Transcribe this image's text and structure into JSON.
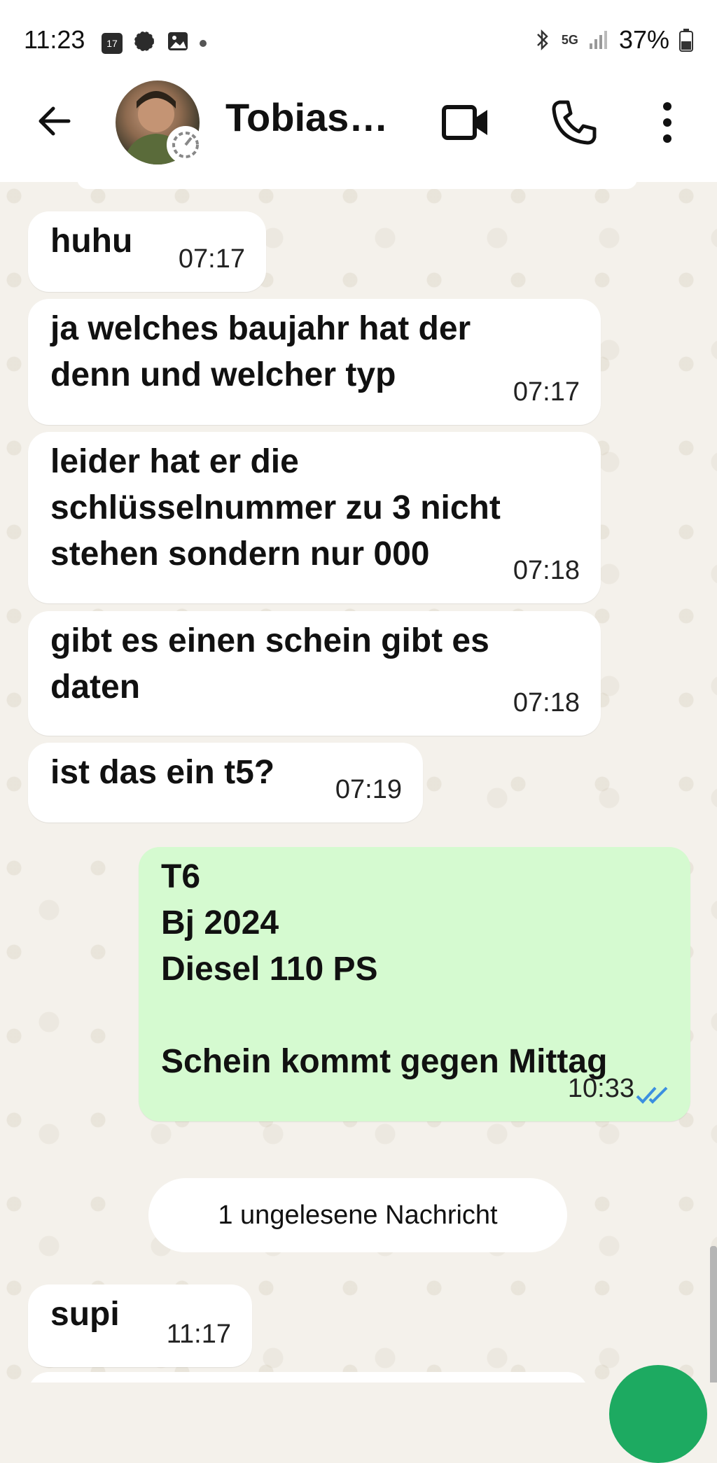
{
  "status_bar": {
    "time": "11:23",
    "calendar_badge": "17",
    "network": "5G",
    "battery": "37%"
  },
  "header": {
    "contact_name": "Tobias…"
  },
  "messages": [
    {
      "text": "huhu",
      "time": "07:17",
      "direction": "in"
    },
    {
      "text": "ja welches baujahr hat der\ndenn und welcher typ",
      "time": "07:17",
      "direction": "in"
    },
    {
      "text": "leider hat er die\nschlüsselnummer zu 3 nicht\nstehen sondern nur 000",
      "time": "07:18",
      "direction": "in"
    },
    {
      "text": "gibt es einen schein gibt es\ndaten",
      "time": "07:18",
      "direction": "in"
    },
    {
      "text": "ist das ein t5?",
      "time": "07:19",
      "direction": "in"
    },
    {
      "text": "T6\nBj 2024\nDiesel 110 PS\n\nSchein kommt gegen Mittag",
      "time": "10:33",
      "direction": "out",
      "status": "read"
    },
    {
      "text": "supi",
      "time": "11:17",
      "direction": "in"
    }
  ],
  "unread_notice": "1 ungelesene Nachricht",
  "colors": {
    "outgoing_bubble": "#d5fad0",
    "incoming_bubble": "#ffffff",
    "read_ticks": "#3b8fe0",
    "fab": "#1daa61"
  }
}
